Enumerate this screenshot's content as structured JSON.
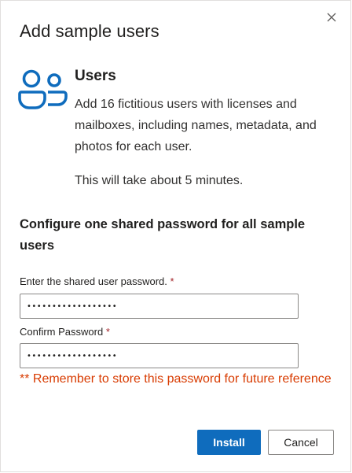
{
  "dialog": {
    "title": "Add sample users",
    "close_icon": "close-icon"
  },
  "users": {
    "icon": "people-icon",
    "heading": "Users",
    "description": "Add 16 fictitious users with licenses and mailboxes, including names, metadata, and photos for each user.",
    "time_note": "This will take about 5 minutes."
  },
  "password_section": {
    "heading": "Configure one shared password for all sample users",
    "password_label": "Enter the shared user password.",
    "confirm_label": "Confirm Password",
    "required_marker": "*",
    "password_value": "••••••••••••••••••",
    "confirm_value": "••••••••••••••••••",
    "warning": "** Remember to store this password for future reference"
  },
  "actions": {
    "install_label": "Install",
    "cancel_label": "Cancel"
  },
  "colors": {
    "accent": "#0f6cbd",
    "warning": "#d83b01",
    "required": "#a4262c",
    "icon": "#0f6cbd"
  }
}
